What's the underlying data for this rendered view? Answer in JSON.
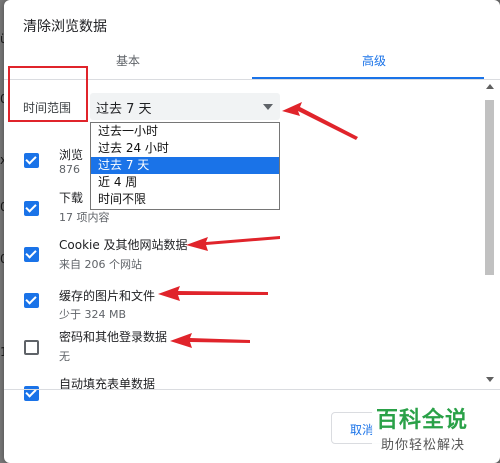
{
  "background": {
    "fragments": [
      "ü",
      "0",
      "x",
      "0",
      "0",
      "1"
    ]
  },
  "dialog": {
    "title": "清除浏览数据",
    "tabs": [
      {
        "label": "基本",
        "active": false
      },
      {
        "label": "高级",
        "active": true
      }
    ],
    "time_range": {
      "label": "时间范围",
      "selected": "过去 7 天",
      "options": [
        "过去一小时",
        "过去 24 小时",
        "过去 7 天",
        "近 4 周",
        "时间不限"
      ],
      "selected_index": 2
    },
    "items": [
      {
        "title": "浏览",
        "subtitle": "876",
        "checked": true
      },
      {
        "title": "下载",
        "subtitle": "17 项内容",
        "checked": true
      },
      {
        "title": "Cookie 及其他网站数据",
        "subtitle": "来自 206 个网站",
        "checked": true
      },
      {
        "title": "缓存的图片和文件",
        "subtitle": "少于 324 MB",
        "checked": true
      },
      {
        "title": "密码和其他登录数据",
        "subtitle": "无",
        "checked": false
      },
      {
        "title": "自动填充表单数据",
        "subtitle": "",
        "checked": true
      }
    ],
    "cancel_label": "取消"
  },
  "watermark": {
    "main": "百科全说",
    "sub": "助你轻松解决"
  },
  "colors": {
    "accent": "#1a73e8",
    "annotation_red": "#e0242b",
    "watermark_green": "#2aa148"
  }
}
